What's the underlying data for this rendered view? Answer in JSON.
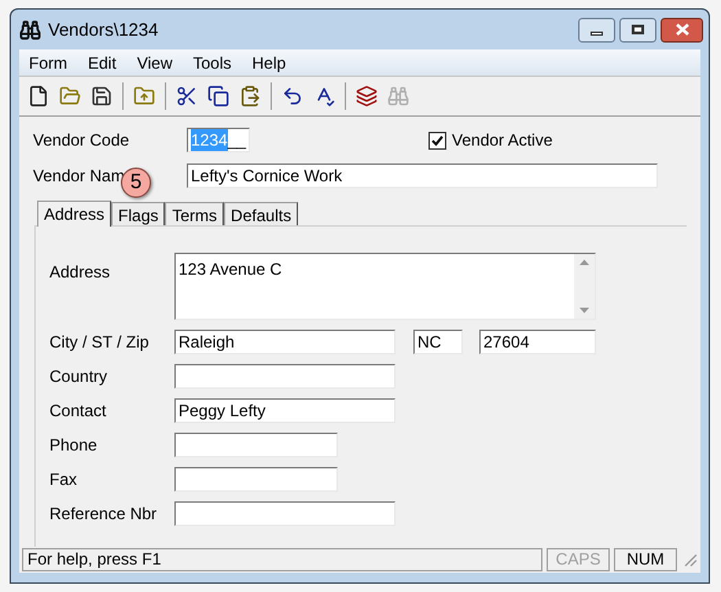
{
  "window": {
    "title": "Vendors\\1234"
  },
  "menu": [
    "Form",
    "Edit",
    "View",
    "Tools",
    "Help"
  ],
  "toolbar": [
    {
      "disabled": false
    },
    {
      "disabled": false
    },
    {
      "disabled": false
    },
    {
      "disabled": false
    },
    {
      "disabled": false
    },
    {
      "disabled": false
    },
    {
      "disabled": false
    },
    {
      "disabled": false
    },
    {
      "disabled": false
    },
    {
      "disabled": false
    },
    {
      "disabled": true
    }
  ],
  "vendor_code": {
    "label": "Vendor Code",
    "value": "1234",
    "mask": "__"
  },
  "vendor_active": {
    "label": "Vendor Active",
    "checked": true
  },
  "vendor_name": {
    "label": "Vendor Nam",
    "value": "Lefty's Cornice Work"
  },
  "callout": {
    "text": "5"
  },
  "tabs": [
    {
      "label": "Address",
      "selected": true
    },
    {
      "label": "Flags",
      "selected": false
    },
    {
      "label": "Terms",
      "selected": false
    },
    {
      "label": "Defaults",
      "selected": false
    }
  ],
  "fields": [
    {
      "label": "Address",
      "kind": "multiline",
      "value": "123 Avenue C"
    },
    {
      "label": "City / ST / Zip",
      "kind": "triple",
      "city": "Raleigh",
      "state": "NC",
      "zip": "27604"
    },
    {
      "label": "Country",
      "kind": "wide"
    },
    {
      "label": "Contact",
      "kind": "wide",
      "value": "Peggy Lefty"
    },
    {
      "label": "Phone",
      "kind": "short"
    },
    {
      "label": "Fax",
      "kind": "short"
    },
    {
      "label": "Reference Nbr",
      "kind": "wide"
    }
  ],
  "status_bar": {
    "text": "For help, press F1",
    "indicators": [
      {
        "label": "CAPS",
        "on": false
      },
      {
        "label": "NUM",
        "on": true
      }
    ]
  }
}
